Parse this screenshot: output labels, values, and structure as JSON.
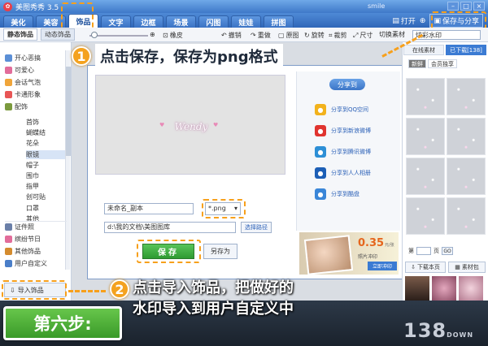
{
  "app": {
    "title": "美图秀秀 3.5",
    "user": "smile"
  },
  "tabs": [
    "美化",
    "美容",
    "饰品",
    "文字",
    "边框",
    "场景",
    "闪图",
    "娃娃",
    "拼图"
  ],
  "active_tab": "饰品",
  "top_actions": {
    "open": "打开",
    "save_share": "保存与分享"
  },
  "toolbar": {
    "static_tab": "静态饰品",
    "animated_tab": "动态饰品",
    "eraser": "橡皮",
    "actual_size": "原图",
    "undo": "撤销",
    "redo": "重做",
    "rotate": "旋转",
    "crop": "裁剪",
    "size": "尺寸",
    "switch_material": "切换素材",
    "watermark_select": "炫彩水印"
  },
  "sidebar": {
    "items": [
      "开心恶搞",
      "可爱心",
      "会话气泡",
      "卡通形象",
      "配饰"
    ],
    "subitems": [
      "首饰",
      "蝴蝶结",
      "花朵",
      "眼镜",
      "帽子",
      "围巾",
      "指甲",
      "创可贴",
      "口罩",
      "其他"
    ],
    "selected_sub": "眼镜",
    "bottom_items": [
      "证件照",
      "缤纷节日",
      "其他饰品",
      "用户自定义"
    ],
    "import_button": "导入饰品"
  },
  "dialog": {
    "watermark_text": "Wendy",
    "filename": "未命名_副本",
    "format": "*.png",
    "path": "d:\\我的文档\\美图图库",
    "choose_path": "选择路径",
    "save": "保存",
    "save_as": "另存为"
  },
  "share": {
    "header": "分享到",
    "items": [
      {
        "label": "分享到QQ空间",
        "icon": "qzone-icon",
        "color": "#f2b21c"
      },
      {
        "label": "分享到新浪微博",
        "icon": "weibo-icon",
        "color": "#e0342f"
      },
      {
        "label": "分享到腾讯微博",
        "icon": "tencent-weibo-icon",
        "color": "#2d8fd6"
      },
      {
        "label": "分享到人人相册",
        "icon": "renren-icon",
        "color": "#1d5fb6"
      },
      {
        "label": "分享到酷盘",
        "icon": "kupan-icon",
        "color": "#3a86d8"
      }
    ],
    "ad_price": "0.35",
    "ad_unit": "元/张",
    "ad_sub": "照片冲印",
    "ad_button": "立即冲印"
  },
  "right_panel": {
    "tab_online": "在线素材",
    "tab_downloaded": "已下载[138]",
    "filter_new": "新鲜",
    "filter_member": "会员独享",
    "pager_prefix": "第",
    "page_suffix": "页",
    "go": "GO",
    "download_page": "下载本页",
    "material_pack": "素材包"
  },
  "annotations": {
    "step1_num": "1",
    "step1_text": "点击保存，保存为png格式",
    "step2_num": "2",
    "step2_text_line1": "点击导入饰品，把做好的",
    "step2_text_line2": "水印导入到用户自定义中",
    "step_badge": "第六步:",
    "brand": "138",
    "brand_sub": "DOWN"
  },
  "colors": {
    "accent_orange": "#f7a01c",
    "title_blue": "#3e78c8",
    "save_green": "#2e9a31"
  }
}
